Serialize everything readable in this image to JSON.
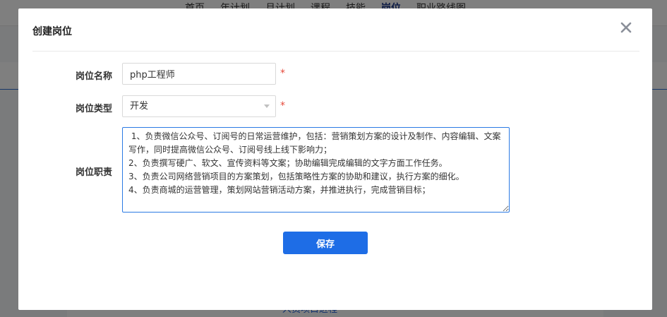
{
  "background": {
    "nav_items": [
      {
        "label": "首页"
      },
      {
        "label": "年计划"
      },
      {
        "label": "月计划"
      },
      {
        "label": "课程"
      },
      {
        "label": "技能"
      },
      {
        "label": "岗位"
      },
      {
        "label": "职业路线图"
      }
    ],
    "active_nav": "岗位",
    "bottom_link": "人员项目进程"
  },
  "modal": {
    "title": "创建岗位",
    "close_icon": "close-icon",
    "fields": {
      "name": {
        "label": "岗位名称",
        "value": "php工程师",
        "required_mark": "*"
      },
      "type": {
        "label": "岗位类型",
        "selected": "开发",
        "required_mark": "*"
      },
      "duty": {
        "label": "岗位职责",
        "value": " 1、负责微信公众号、订阅号的日常运营维护，包括：营销策划方案的设计及制作、内容编辑、文案写作，同时提高微信公众号、订阅号线上线下影响力；\n2、负责撰写硬广、软文、宣传资料等文案；协助编辑完成编辑的文字方面工作任务。\n3、负责公司网络营销项目的方案策划，包括策略性方案的协助和建议，执行方案的细化。\n4、负责商城的运营管理，策划网站营销活动方案，并推进执行，完成营销目标；"
      }
    },
    "save_label": "保存"
  },
  "colors": {
    "primary": "#1e6de6",
    "required": "#e64a3b",
    "focus_border": "#2b7ae4"
  }
}
